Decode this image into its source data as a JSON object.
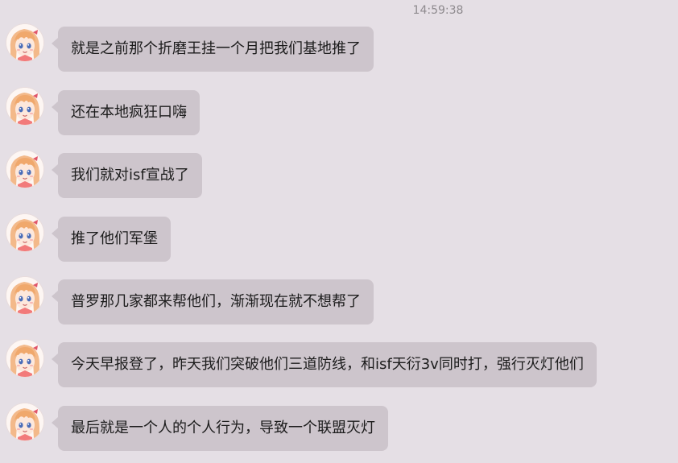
{
  "chat": {
    "timestamp": "14:59:38",
    "messages": [
      {
        "avatar": "anime-girl-avatar-icon",
        "text": "就是之前那个折磨王挂一个月把我们基地推了"
      },
      {
        "avatar": "anime-girl-avatar-icon",
        "text": "还在本地疯狂口嗨"
      },
      {
        "avatar": "anime-girl-avatar-icon",
        "text": "我们就对isf宣战了"
      },
      {
        "avatar": "anime-girl-avatar-icon",
        "text": "推了他们军堡"
      },
      {
        "avatar": "anime-girl-avatar-icon",
        "text": "普罗那几家都来帮他们，渐渐现在就不想帮了"
      },
      {
        "avatar": "anime-girl-avatar-icon",
        "text": "今天早报登了，昨天我们突破他们三道防线，和isf天衍3v同时打，强行灭灯他们"
      },
      {
        "avatar": "anime-girl-avatar-icon",
        "text": "最后就是一个人的个人行为，导致一个联盟灭灯"
      }
    ]
  },
  "colors": {
    "background": "#e5dfe5",
    "bubble": "#cdc5cc",
    "text": "#1c1c1c",
    "timestamp": "#8e8a8e"
  }
}
